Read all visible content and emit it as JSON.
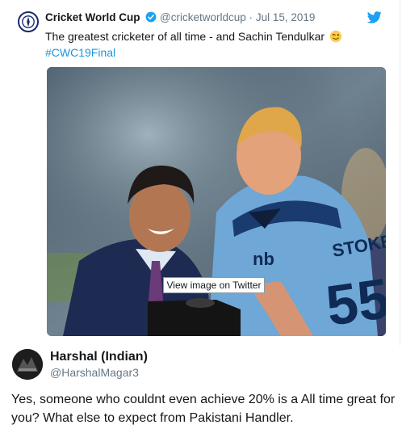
{
  "tweet": {
    "author_name": "Cricket World Cup",
    "author_handle": "@cricketworldcup",
    "separator": "·",
    "date": "Jul 15, 2019",
    "text": "The greatest cricketer of all time - and Sachin Tendulkar",
    "hashtag": "#CWC19Final",
    "emoji": "winking-face",
    "verified": true,
    "image_button_label": "View image on Twitter",
    "jersey_name": "STOKES",
    "jersey_number": "55"
  },
  "reply": {
    "author_name": "Harshal (Indian)",
    "author_handle": "@HarshalMagar3",
    "text": "Yes, someone who couldnt even achieve 20% is a All time great for you? What else to expect from Pakistani Handler."
  },
  "colors": {
    "link": "#1b95e0",
    "secondary_text": "#657786",
    "twitter_blue": "#1da1f2",
    "border": "#e6ecf0"
  },
  "icons": [
    "cwc-logo-icon",
    "verified-badge-icon",
    "twitter-bird-icon",
    "wink-emoji-icon",
    "reply-avatar"
  ]
}
